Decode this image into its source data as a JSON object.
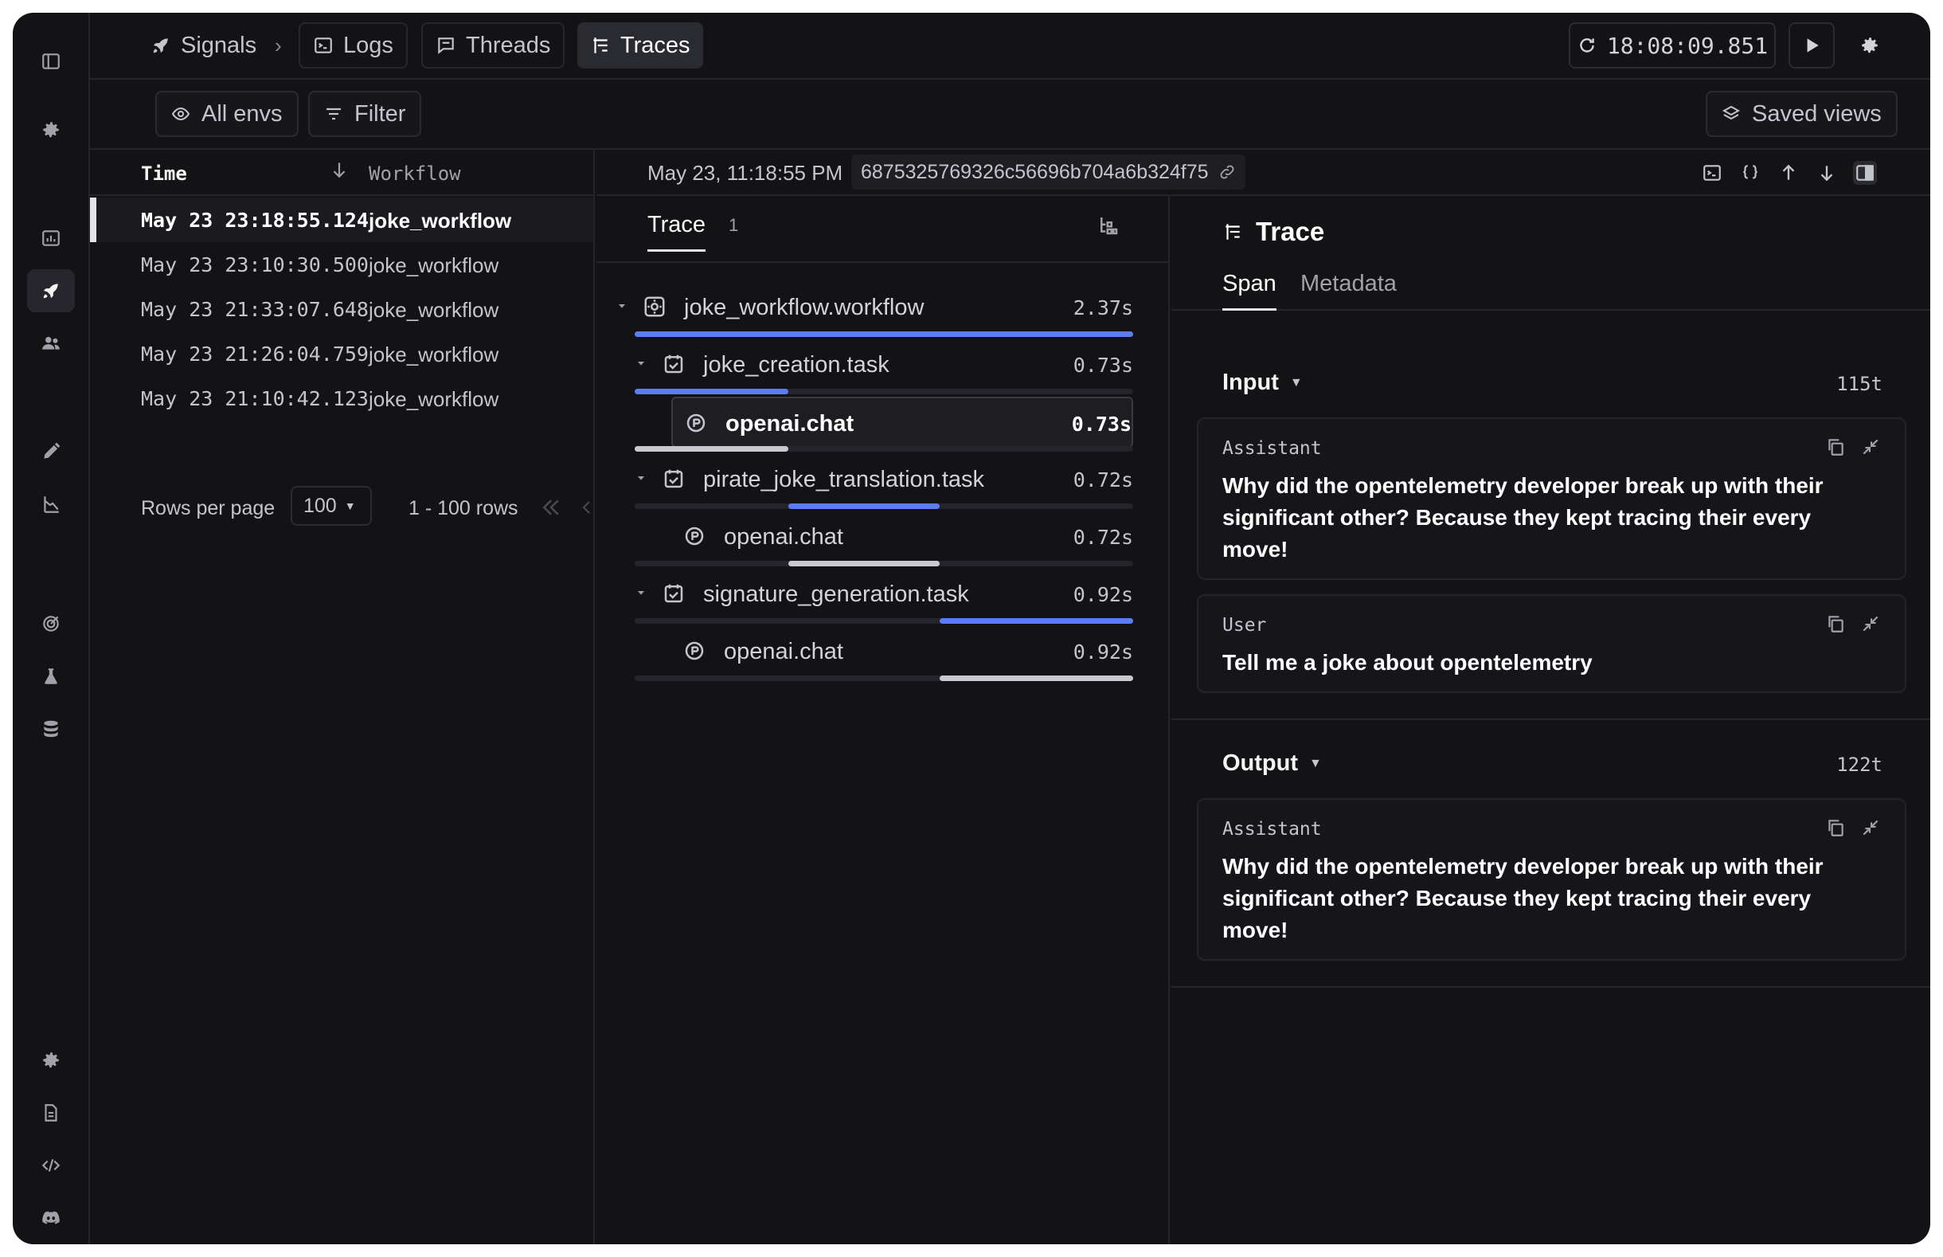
{
  "topbar": {
    "breadcrumbs": [
      {
        "label": "Signals",
        "icon": "rocket-icon"
      },
      {
        "label": "Logs",
        "icon": "terminal-icon"
      },
      {
        "label": "Threads",
        "icon": "chat-icon"
      },
      {
        "label": "Traces",
        "icon": "traces-icon"
      }
    ],
    "separator": "›",
    "clock": "18:08:09.851"
  },
  "filters": {
    "envs": "All envs",
    "filter": "Filter",
    "saved_views": "Saved views"
  },
  "list": {
    "columns": {
      "time": "Time",
      "workflow": "Workflow"
    },
    "rows": [
      {
        "time": "May 23 23:18:55.124",
        "workflow": "joke_workflow"
      },
      {
        "time": "May 23 23:10:30.500",
        "workflow": "joke_workflow"
      },
      {
        "time": "May 23 21:33:07.648",
        "workflow": "joke_workflow"
      },
      {
        "time": "May 23 21:26:04.759",
        "workflow": "joke_workflow"
      },
      {
        "time": "May 23 21:10:42.123",
        "workflow": "joke_workflow"
      }
    ],
    "pager": {
      "rows_per_page_label": "Rows per page",
      "rows_per_page": "100",
      "range": "1 - 100 rows"
    }
  },
  "detail": {
    "date": "May 23, 11:18:55 PM",
    "trace_id": "6875325769326c56696b704a6b324f75",
    "tree": {
      "tab": "Trace",
      "count": "1",
      "spans": [
        {
          "name": "joke_workflow.workflow",
          "duration": "2.37s",
          "start": 0.0,
          "end": 1.0
        },
        {
          "name": "joke_creation.task",
          "duration": "0.73s",
          "start": 0.0,
          "end": 0.308
        },
        {
          "name": "openai.chat",
          "duration": "0.73s",
          "start": 0.0,
          "end": 0.308
        },
        {
          "name": "pirate_joke_translation.task",
          "duration": "0.72s",
          "start": 0.308,
          "end": 0.612
        },
        {
          "name": "openai.chat",
          "duration": "0.72s",
          "start": 0.308,
          "end": 0.612
        },
        {
          "name": "signature_generation.task",
          "duration": "0.92s",
          "start": 0.612,
          "end": 1.0
        },
        {
          "name": "openai.chat",
          "duration": "0.92s",
          "start": 0.612,
          "end": 1.0
        }
      ]
    },
    "span_panel": {
      "title": "Trace",
      "tabs": [
        "Span",
        "Metadata"
      ],
      "input": {
        "label": "Input",
        "tokens": "115t",
        "messages": [
          {
            "role": "Assistant",
            "text": "Why did the opentelemetry developer break up with their significant other? Because they kept tracing their every move!"
          },
          {
            "role": "User",
            "text": "Tell me a joke about opentelemetry"
          }
        ]
      },
      "output": {
        "label": "Output",
        "tokens": "122t",
        "messages": [
          {
            "role": "Assistant",
            "text": "Why did the opentelemetry developer break up with their significant other? Because they kept tracing their every move!"
          }
        ]
      }
    }
  },
  "colors": {
    "accent_bar": "#5b7cf6",
    "child_bar": "#c9c9cf"
  }
}
